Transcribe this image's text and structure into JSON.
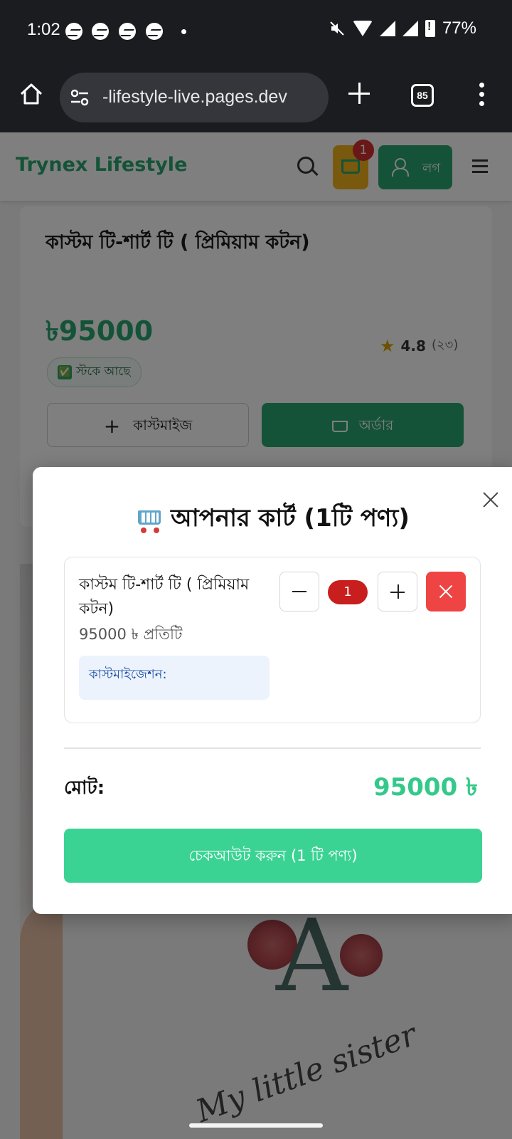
{
  "status_bar": {
    "time": "1:02",
    "battery": "77%",
    "notification_icons": [
      "messenger-icon",
      "messenger-icon",
      "messenger-icon",
      "messenger-icon"
    ],
    "system_icons": [
      "mute-icon",
      "wifi-icon",
      "signal-icon",
      "battery-icon"
    ]
  },
  "browser": {
    "url": "-lifestyle-live.pages.dev",
    "tab_count": "85"
  },
  "site": {
    "brand": "Trynex Lifestyle",
    "cart_count": "1",
    "login_label": "লগ"
  },
  "product": {
    "title": "কাস্টম টি-শার্ট টি ( প্রিমিয়াম কটন)",
    "price": "৳95000",
    "rating": "4.8",
    "rating_count": "(২৩)",
    "stock_icon": "✅",
    "stock": "স্টকে আছে",
    "customize_label": "কাস্টমাইজ",
    "order_label": "অর্ডার",
    "image_text": "My little sister"
  },
  "cart_modal": {
    "title": "আপনার কার্ট (1টি পণ্য)",
    "item": {
      "name": "কাস্টম টি-শার্ট টি ( প্রিমিয়াম কটন)",
      "unit_price": "95000 ৳ প্রতিটি",
      "customization_label": "কাস্টমাইজেশন:",
      "quantity": "1"
    },
    "total_label": "মোট:",
    "total_value": "95000 ৳",
    "checkout_label": "চেকআউট করুন (1 টি পণ্য)"
  },
  "colors": {
    "brand_green": "#2ba670",
    "checkout_green": "#3bd394",
    "remove_red": "#ef4444",
    "cart_yellow": "#f2b21b"
  }
}
